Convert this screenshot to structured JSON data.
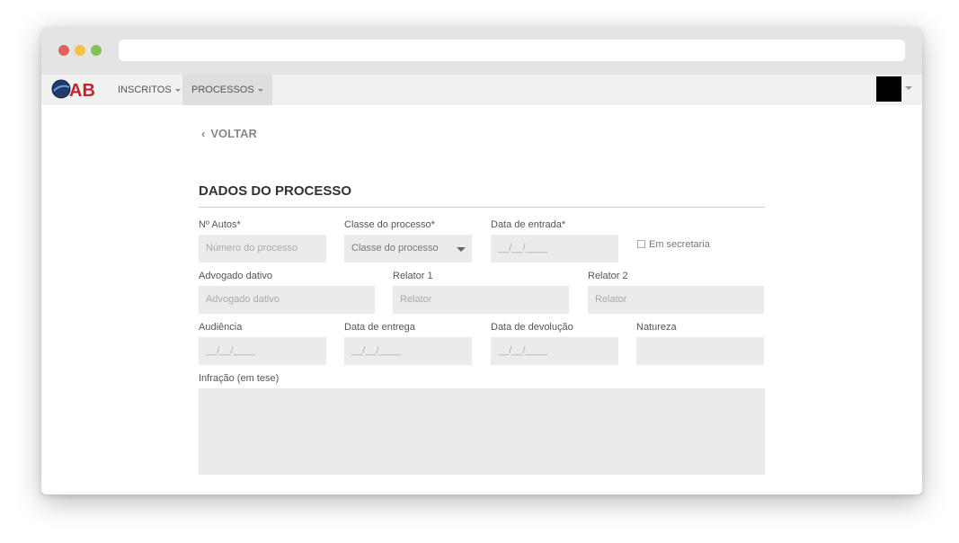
{
  "nav": {
    "items": [
      {
        "label": "INSCRITOS"
      },
      {
        "label": "PROCESSOS"
      }
    ],
    "logo_text": "OAB"
  },
  "back_label": "VOLTAR",
  "section_title": "DADOS DO PROCESSO",
  "form": {
    "numero_autos": {
      "label": "Nº Autos*",
      "placeholder": "Número do processo"
    },
    "classe": {
      "label": "Classe do processo*",
      "value": "Classe do processo"
    },
    "data_entrada": {
      "label": "Data de entrada*",
      "placeholder": "__/__/____"
    },
    "em_secretaria": {
      "label": "Em secretaria",
      "checked": false
    },
    "advogado_dativo": {
      "label": "Advogado dativo",
      "placeholder": "Advogado dativo"
    },
    "relator1": {
      "label": "Relator 1",
      "placeholder": "Relator"
    },
    "relator2": {
      "label": "Relator 2",
      "placeholder": "Relator"
    },
    "audiencia": {
      "label": "Audiência",
      "placeholder": "__/__/____"
    },
    "data_entrega": {
      "label": "Data de entrega",
      "placeholder": "__/__/____"
    },
    "data_devolucao": {
      "label": "Data de devolução",
      "placeholder": "__/__/____"
    },
    "natureza": {
      "label": "Natureza",
      "placeholder": ""
    },
    "infracao": {
      "label": "Infração (em tese)",
      "placeholder": ""
    }
  },
  "colors": {
    "brand_blue": "#1f3a6b",
    "brand_red": "#c0272d",
    "field_bg": "#ebebeb"
  }
}
